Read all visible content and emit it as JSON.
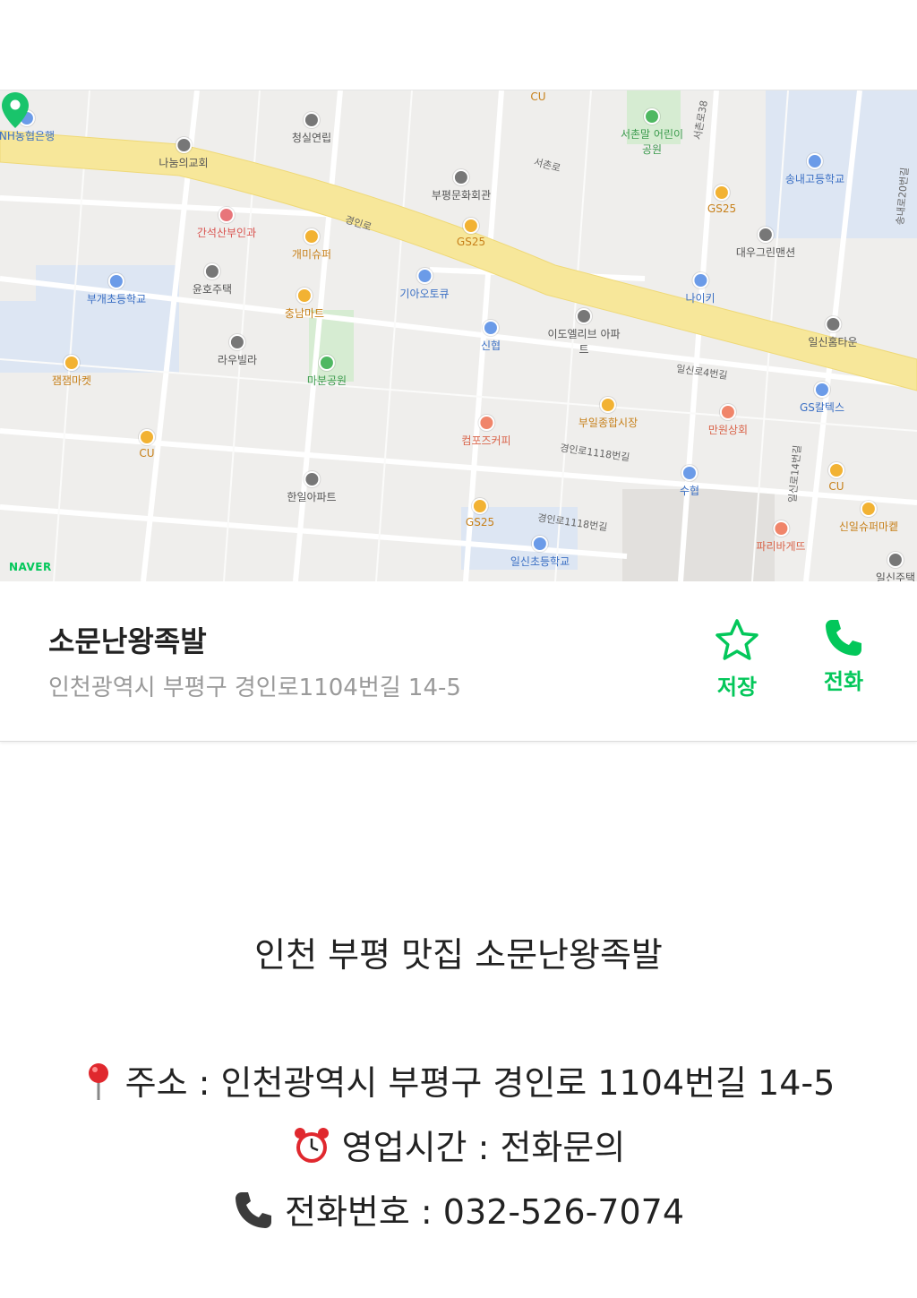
{
  "map": {
    "brand": "NAVER",
    "pois": [
      {
        "label": "NH농협은행",
        "kind": "blue"
      },
      {
        "label": "청실연립",
        "kind": "gray"
      },
      {
        "label": "나눔의교회",
        "kind": "gray"
      },
      {
        "label": "부평문화회관",
        "kind": "gray"
      },
      {
        "label": "간석산부인과",
        "kind": "red"
      },
      {
        "label": "개미슈퍼",
        "kind": "orange"
      },
      {
        "label": "GS25",
        "kind": "orange"
      },
      {
        "label": "서촌말 어린이공원",
        "kind": "green"
      },
      {
        "label": "송내고등학교",
        "kind": "blue"
      },
      {
        "label": "GS25",
        "kind": "orange"
      },
      {
        "label": "대우그린맨션",
        "kind": "gray"
      },
      {
        "label": "부개초등학교",
        "kind": "blue"
      },
      {
        "label": "윤호주택",
        "kind": "gray"
      },
      {
        "label": "기아오토큐",
        "kind": "blue"
      },
      {
        "label": "나이키",
        "kind": "blue"
      },
      {
        "label": "충남마트",
        "kind": "orange"
      },
      {
        "label": "신협",
        "kind": "blue"
      },
      {
        "label": "이도엘리브 아파트",
        "kind": "gray"
      },
      {
        "label": "일신홈타운",
        "kind": "gray"
      },
      {
        "label": "라우빌라",
        "kind": "gray"
      },
      {
        "label": "마분공원",
        "kind": "green"
      },
      {
        "label": "잼잼마켓",
        "kind": "orange"
      },
      {
        "label": "GS칼텍스",
        "kind": "blue"
      },
      {
        "label": "부일종합시장",
        "kind": "orange"
      },
      {
        "label": "만원상회",
        "kind": "coral"
      },
      {
        "label": "컴포즈커피",
        "kind": "coral"
      },
      {
        "label": "CU",
        "kind": "orange"
      },
      {
        "label": "한일아파트",
        "kind": "gray"
      },
      {
        "label": "수협",
        "kind": "blue"
      },
      {
        "label": "CU",
        "kind": "orange"
      },
      {
        "label": "GS25",
        "kind": "orange"
      },
      {
        "label": "신일슈퍼마켙",
        "kind": "orange"
      },
      {
        "label": "파리바게뜨",
        "kind": "coral"
      },
      {
        "label": "일신초등학교",
        "kind": "blue"
      },
      {
        "label": "일신주택",
        "kind": "gray"
      },
      {
        "label": "CU",
        "kind": "orange"
      }
    ],
    "roads": [
      "경인로",
      "서촌로",
      "일신로4번길",
      "경인로1118번길",
      "경인로1118번길",
      "서촌로38",
      "일신로14번길",
      "송내로20번길"
    ]
  },
  "place": {
    "name": "소문난왕족발",
    "address": "인천광역시 부평구 경인로1104번길 14-5",
    "save_label": "저장",
    "call_label": "전화"
  },
  "content": {
    "headline": "인천 부평 맛집 소문난왕족발",
    "address_line": "주소 : 인천광역시 부평구 경인로 1104번길 14-5",
    "hours_line": "영업시간 : 전화문의",
    "phone_line": "전화번호 : 032-526-7074"
  },
  "icons": {
    "pin": "round-pushpin-icon",
    "clock": "alarm-clock-icon",
    "phone": "telephone-receiver-icon",
    "save": "star-outline-icon",
    "call": "phone-icon"
  },
  "colors": {
    "accent": "#03c75a",
    "road": "#f7e79a",
    "muted": "#9a9a9a"
  }
}
